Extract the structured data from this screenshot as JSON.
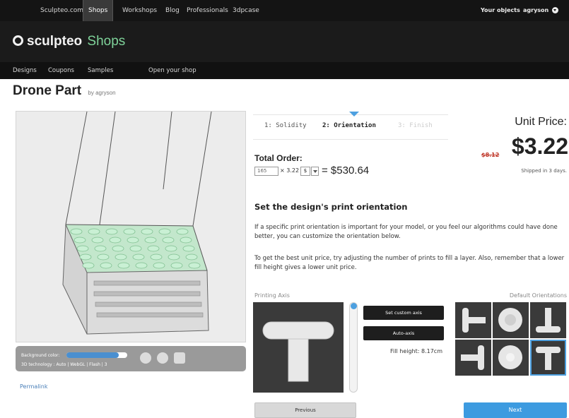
{
  "topnav": {
    "items": [
      {
        "label": "Sculpteo.com"
      },
      {
        "label": "Shops"
      },
      {
        "label": "Workshops"
      },
      {
        "label": "Blog"
      },
      {
        "label": "Professionals"
      },
      {
        "label": "3dpcase"
      }
    ],
    "your_objects": "Your objects",
    "username": "agryson"
  },
  "header": {
    "logo_text": "sculpteo",
    "logo_section": "Shops"
  },
  "subnav": {
    "items": [
      {
        "label": "Designs"
      },
      {
        "label": "Coupons"
      },
      {
        "label": "Samples"
      },
      {
        "label": "Open your shop"
      }
    ]
  },
  "design": {
    "title": "Drone Part",
    "by": "by agryson"
  },
  "viewer": {
    "background_color_label": "Background color:",
    "tech_label": "3D technology : Auto | WebGL | Flash | 3",
    "permalink": "Permalink"
  },
  "steps": [
    {
      "label": "1: Solidity",
      "state": "done"
    },
    {
      "label": "2: Orientation",
      "state": "active"
    },
    {
      "label": "3: Finish",
      "state": "upcoming"
    }
  ],
  "order": {
    "total_label": "Total Order:",
    "quantity": "165",
    "times_text": "× 3.22",
    "currency": "$",
    "total_value": "= $530.64"
  },
  "price": {
    "unit_label": "Unit Price:",
    "old_price": "$8.12",
    "unit_value": "$3.22",
    "shipped": "Shipped in 3 days."
  },
  "orientation": {
    "section_title": "Set the design's print orientation",
    "paragraph1": "If a specific print orientation is important for your model, or you feel our algorithms could have done better, you can customize the orientation below.",
    "paragraph2": "To get the best unit price, try adjusting the number of prints to fill a layer. Also, remember that a lower fill height gives a lower unit price.",
    "printing_axis_label": "Printing Axis",
    "set_custom_axis": "Set custom axis",
    "auto_axis": "Auto-axis",
    "fill_height": "Fill height: 8.17cm",
    "default_orientations_label": "Default Orientations"
  },
  "footer_buttons": {
    "previous": "Previous",
    "next": "Next"
  },
  "colors": {
    "accent_blue": "#3d9be0",
    "shops_green": "#7fd39a",
    "old_price_red": "#c0392b",
    "dark_bar": "#141414"
  }
}
